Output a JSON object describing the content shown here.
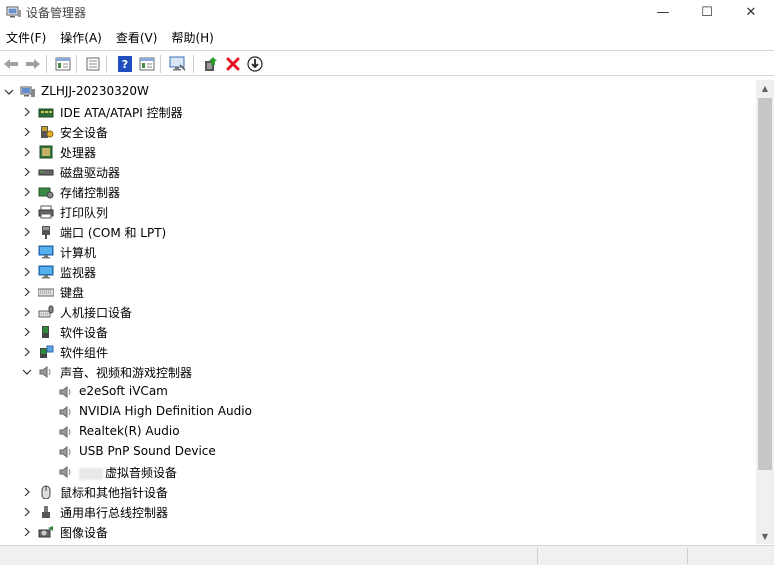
{
  "window": {
    "title": "设备管理器"
  },
  "window_controls": {
    "minimize": "—",
    "maximize": "☐",
    "close": "✕"
  },
  "menu": [
    "文件(F)",
    "操作(A)",
    "查看(V)",
    "帮助(H)"
  ],
  "toolbar_buttons": [
    "back-icon",
    "forward-icon",
    "properties-icon",
    "refresh-icon",
    "help-icon",
    "view-icon",
    "scan-hardware-icon",
    "update-driver-icon",
    "uninstall-icon",
    "disable-icon"
  ],
  "tree": {
    "root": "ZLHJJ-20230320W",
    "categories": [
      {
        "label": "IDE ATA/ATAPI 控制器",
        "icon": "ide-controller-icon"
      },
      {
        "label": "安全设备",
        "icon": "security-device-icon"
      },
      {
        "label": "处理器",
        "icon": "processor-icon"
      },
      {
        "label": "磁盘驱动器",
        "icon": "disk-drive-icon"
      },
      {
        "label": "存储控制器",
        "icon": "storage-controller-icon"
      },
      {
        "label": "打印队列",
        "icon": "printer-icon"
      },
      {
        "label": "端口 (COM 和 LPT)",
        "icon": "port-icon"
      },
      {
        "label": "计算机",
        "icon": "computer-icon"
      },
      {
        "label": "监视器",
        "icon": "monitor-icon"
      },
      {
        "label": "键盘",
        "icon": "keyboard-icon"
      },
      {
        "label": "人机接口设备",
        "icon": "hid-icon"
      },
      {
        "label": "软件设备",
        "icon": "software-device-icon"
      },
      {
        "label": "软件组件",
        "icon": "software-component-icon"
      },
      {
        "label": "声音、视频和游戏控制器",
        "icon": "speaker-icon",
        "expanded": true
      },
      {
        "label": "鼠标和其他指针设备",
        "icon": "mouse-icon"
      },
      {
        "label": "通用串行总线控制器",
        "icon": "usb-icon"
      },
      {
        "label": "图像设备",
        "icon": "camera-icon"
      }
    ],
    "audio_children": [
      "e2eSoft iVCam",
      "NVIDIA High Definition Audio",
      "Realtek(R) Audio",
      "USB PnP Sound Device",
      "虚拟音频设备"
    ]
  },
  "colors": {
    "accent": "#0078d7",
    "uninstall_red": "#e81123",
    "help_blue": "#1f4fbf",
    "scrollbar_thumb": "#c6c6c6"
  }
}
